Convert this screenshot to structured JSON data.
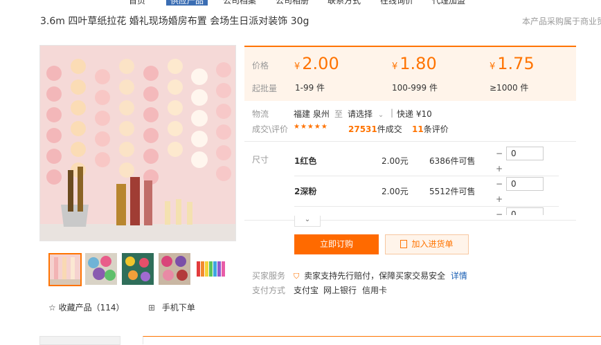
{
  "topnav": {
    "items": [
      "首页",
      "供应产品",
      "公司档案",
      "公司相册",
      "联系方式",
      "在线询价",
      "代理加盟"
    ]
  },
  "product": {
    "title": "3.6m 四叶草纸拉花 婚礼现场婚房布置 会场生日派对装饰 30g"
  },
  "notice": "本产品采购属于商业贸",
  "price": {
    "price_label": "价格",
    "moq_label": "起批量",
    "currency": "¥",
    "tiers": [
      {
        "price": "2.00",
        "range": "1-99 件"
      },
      {
        "price": "1.80",
        "range": "100-999 件"
      },
      {
        "price": "1.75",
        "range": "≥1000 件"
      }
    ]
  },
  "logistics": {
    "label": "物流",
    "origin": "福建 泉州",
    "to": "至",
    "select": "请选择",
    "express": "快递 ¥10"
  },
  "deal": {
    "label": "成交\\评价",
    "stars": "★★★★★",
    "count": "27531",
    "count_suffix": "件成交",
    "reviews": "11",
    "reviews_suffix": "条评价"
  },
  "sku": {
    "label": "尺寸",
    "rows": [
      {
        "name": "1红色",
        "price": "2.00元",
        "stock": "6386件可售",
        "qty": "0"
      },
      {
        "name": "2深粉",
        "price": "2.00元",
        "stock": "5512件可售",
        "qty": "0"
      },
      {
        "name": "",
        "price": "",
        "stock": "",
        "qty": "0"
      }
    ],
    "minus": "−",
    "plus": "+"
  },
  "buttons": {
    "order": "立即订购",
    "cart": "加入进货单"
  },
  "service": {
    "label": "买家服务",
    "text": "卖家支持先行赔付，保障买家交易安全",
    "link": "详情"
  },
  "payment": {
    "label": "支付方式",
    "methods": [
      "支付宝",
      "网上银行",
      "信用卡"
    ]
  },
  "favorite": {
    "label": "收藏产品（114）"
  },
  "mobile": {
    "label": "手机下单"
  },
  "colors": {
    "accent": "#ff7300",
    "price_bg": "#fff4ea",
    "order_btn": "#ff6a00"
  }
}
